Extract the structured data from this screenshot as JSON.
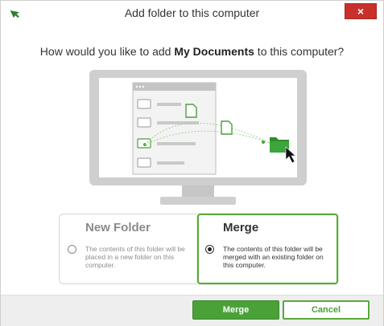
{
  "window": {
    "title": "Add folder to this computer",
    "close_glyph": "×",
    "app_icon": "green-arrow-icon"
  },
  "question": {
    "prefix": "How would you like to add ",
    "folder_name": "My Documents",
    "suffix": " to this computer?"
  },
  "options": {
    "new_folder": {
      "title": "New Folder",
      "description": "The contents of this folder will be placed in a new folder on this computer.",
      "selected": false
    },
    "merge": {
      "title": "Merge",
      "description": "The contents of this folder will be merged with an existing folder on this computer.",
      "selected": true
    }
  },
  "buttons": {
    "merge_label": "Merge",
    "cancel_label": "Cancel"
  },
  "colors": {
    "accent_green": "#4aa138",
    "close_red": "#c9302c",
    "monitor_gray": "#cfcfcf"
  }
}
